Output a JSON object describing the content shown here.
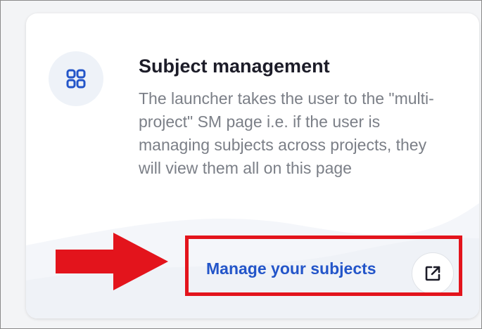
{
  "card": {
    "title": "Subject management",
    "description": "The launcher takes the user to the \"multi-project\" SM page i.e. if the user is managing subjects across projects, they will view them all on this page",
    "link_label": "Manage your subjects"
  },
  "icons": {
    "card_icon": "grid-four-squares-icon",
    "link_icon": "external-link-icon",
    "annotation": "red-arrow-icon"
  },
  "colors": {
    "link": "#2355c9",
    "title": "#1c1c28",
    "description": "#7b7f87",
    "highlight": "#e3141c",
    "icon_bg": "#eef2f8",
    "icon_fg": "#2355c9"
  }
}
